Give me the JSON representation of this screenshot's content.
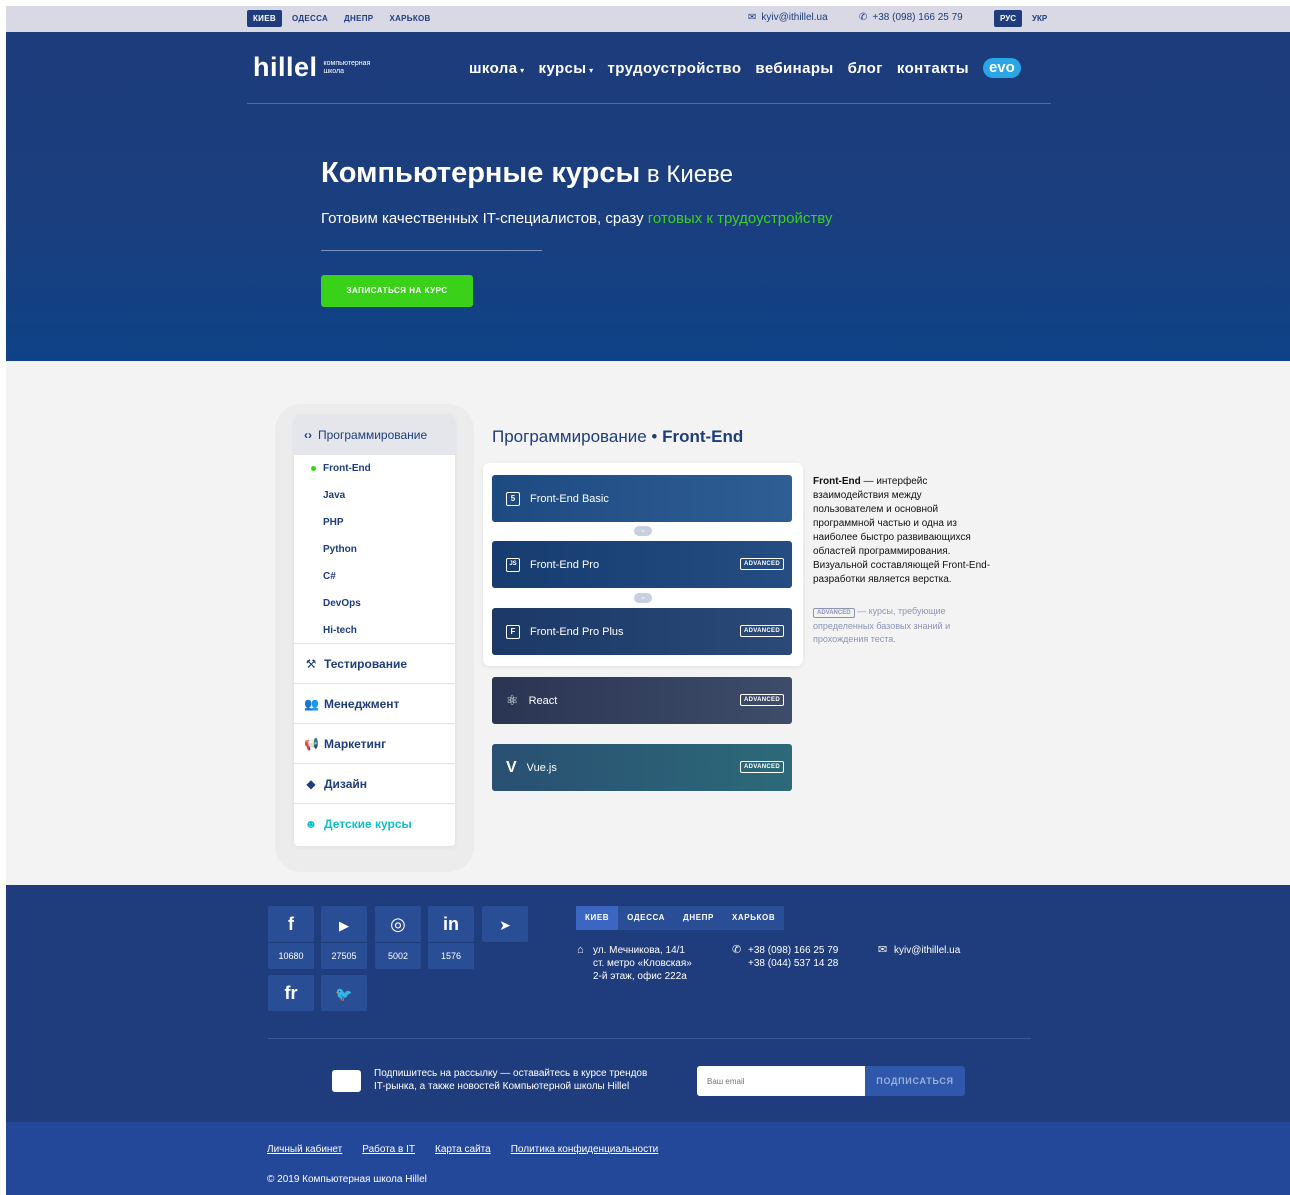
{
  "topbar": {
    "cities": [
      "КИЕВ",
      "ОДЕССА",
      "ДНЕПР",
      "ХАРЬКОВ"
    ],
    "email": "kyiv@ithillel.ua",
    "phone": "+38 (098) 166 25 79",
    "langs": [
      "РУС",
      "УКР"
    ]
  },
  "header": {
    "logo": "hillel",
    "logo_sub": "компьютерная школа",
    "nav": [
      "школа",
      "курсы",
      "трудоустройство",
      "вебинары",
      "блог",
      "контакты"
    ],
    "evo": "evo"
  },
  "hero": {
    "title_bold": "Компьютерные курсы",
    "title_city": " в Киеве",
    "lead": "Готовим качественных IT-специалистов, сразу ",
    "lead_highlight": "готовых к трудоустройству",
    "cta": "ЗАПИСАТЬСЯ НА КУРС"
  },
  "sidebar": {
    "active_category": "Программирование",
    "subitems": [
      "Front-End",
      "Java",
      "PHP",
      "Python",
      "C#",
      "DevOps",
      "Hi-tech"
    ],
    "categories": [
      "Тестирование",
      "Менеджмент",
      "Маркетинг",
      "Дизайн"
    ],
    "kids": "Детские курсы"
  },
  "section": {
    "title_prefix": "Программирование • ",
    "title_bold": "Front-End"
  },
  "courses": [
    {
      "name": "Front-End Basic",
      "icon": "5",
      "advanced": ""
    },
    {
      "name": "Front-End Pro",
      "icon": "JS",
      "advanced": "ADVANCED"
    },
    {
      "name": "Front-End Pro Plus",
      "icon": "F",
      "advanced": "ADVANCED"
    },
    {
      "name": "React",
      "icon": "react-atom-icon",
      "advanced": "ADVANCED"
    },
    {
      "name": "Vue.js",
      "icon": "V",
      "advanced": "ADVANCED"
    }
  ],
  "description": {
    "bold": "Front-End",
    "text": " — интерфейс взаимодействия между пользователем и основной программной частью и одна из наиболее быстро развивающихся областей программирования. Визуальной составляющей Front-End-разработки является верстка."
  },
  "advanced_note": {
    "tag": "ADVANCED",
    "text": " — курсы, требующие определенных базовых знаний и прохождения теста."
  },
  "footer": {
    "socials": [
      {
        "icon": "f",
        "name": "facebook-icon",
        "count": "10680"
      },
      {
        "icon": "▶",
        "name": "youtube-icon",
        "count": "27505"
      },
      {
        "icon": "◎",
        "name": "instagram-icon",
        "count": "5002"
      },
      {
        "icon": "in",
        "name": "linkedin-icon",
        "count": "1576"
      },
      {
        "icon": "➤",
        "name": "telegram-icon",
        "count": ""
      },
      {
        "icon": "fr",
        "name": "freelancer-icon",
        "count": ""
      },
      {
        "icon": "🐦",
        "name": "twitter-icon",
        "count": ""
      }
    ],
    "tabs": [
      "КИЕВ",
      "ОДЕССА",
      "ДНЕПР",
      "ХАРЬКОВ"
    ],
    "address": [
      "ул. Мечникова, 14/1",
      "ст. метро «Кловская»",
      "2-й этаж, офис 222а"
    ],
    "phones": [
      "+38 (098) 166 25 79",
      "+38 (044) 537 14 28"
    ],
    "email": "kyiv@ithillel.ua",
    "subscribe_text_1": "Подпишитесь на рассылку — оставайтесь в курсе трендов",
    "subscribe_text_2": "IT-рынка, а также новостей Компьютерной школы Hillel",
    "email_placeholder": "Ваш email",
    "subscribe_button": "ПОДПИСАТЬСЯ"
  },
  "bottom": {
    "links": [
      "Личный кабинет",
      "Работа в IT",
      "Карта сайта",
      "Политика конфиденциальности"
    ],
    "copyright": "© 2019 Компьютерная школа Hillel"
  },
  "colors": {
    "primary": "#1f3d7c",
    "accent_green": "#39d11a",
    "kids_teal": "#10c1c9",
    "evo_blue": "#2aa6e6"
  }
}
